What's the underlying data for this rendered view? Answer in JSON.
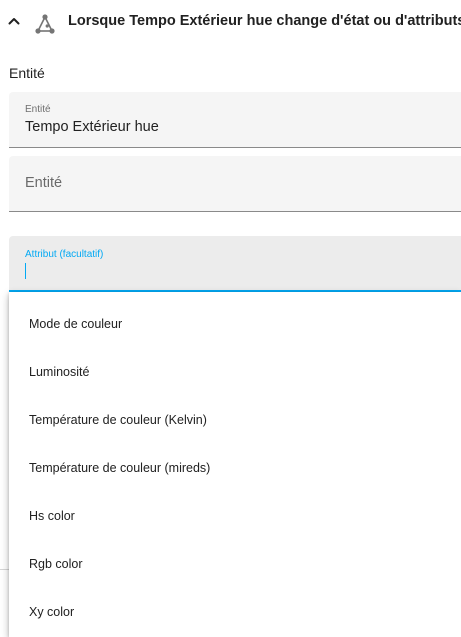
{
  "header": {
    "title": "Lorsque Tempo Extérieur hue change d'état ou d'attributs",
    "expand_icon": "chevron-up-icon",
    "trigger_icon": "state-trigger-icon"
  },
  "section_label": "Entité",
  "fields": {
    "entity_selected": {
      "label": "Entité",
      "value": "Tempo Extérieur hue"
    },
    "entity_empty": {
      "label": "Entité"
    },
    "attribute": {
      "label": "Attribut (facultatif)",
      "value": ""
    }
  },
  "dropdown": {
    "options": [
      "Mode de couleur",
      "Luminosité",
      "Température de couleur (Kelvin)",
      "Température de couleur (mireds)",
      "Hs color",
      "Rgb color",
      "Xy color"
    ]
  },
  "colors": {
    "accent": "#03a9f4",
    "field_bg": "#f5f5f5",
    "text": "#212121"
  }
}
